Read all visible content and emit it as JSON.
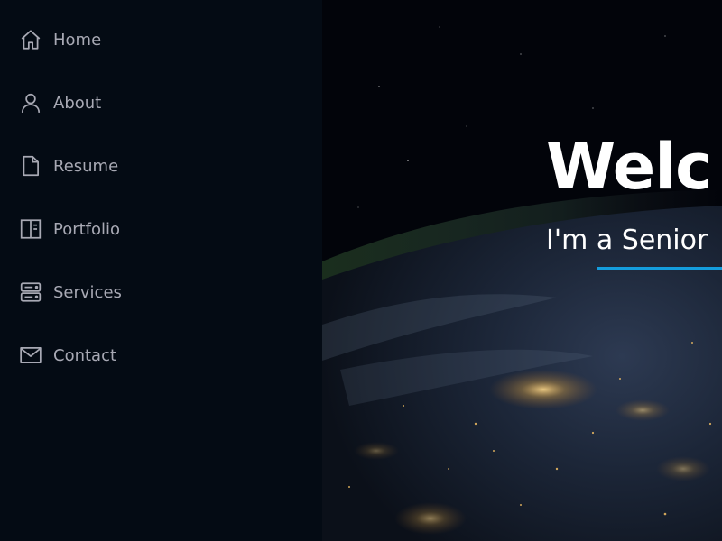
{
  "sidebar": {
    "items": [
      {
        "label": "Home",
        "icon": "home-icon"
      },
      {
        "label": "About",
        "icon": "person-icon"
      },
      {
        "label": "Resume",
        "icon": "file-icon"
      },
      {
        "label": "Portfolio",
        "icon": "book-half-icon"
      },
      {
        "label": "Services",
        "icon": "server-icon"
      },
      {
        "label": "Contact",
        "icon": "envelope-icon"
      }
    ]
  },
  "hero": {
    "title": "Welc",
    "subtitle": "I'm a Senior",
    "accent_color": "#149ddd"
  },
  "colors": {
    "sidebar_bg": "#040b14",
    "nav_text": "#a8a9b4"
  }
}
